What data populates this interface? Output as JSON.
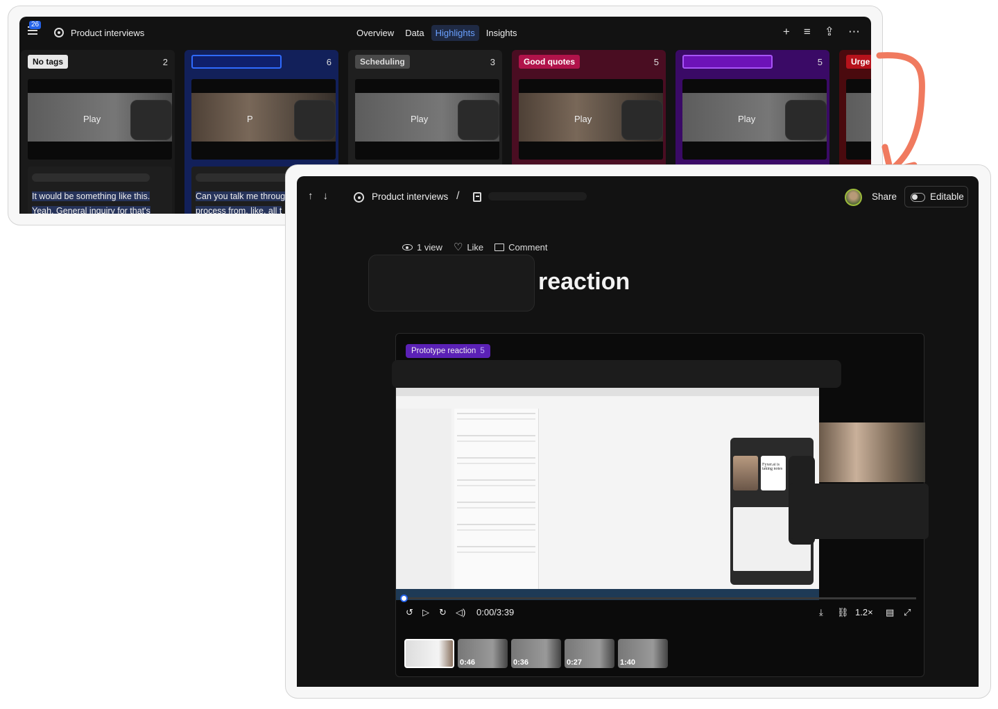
{
  "board": {
    "notif_count": "26",
    "project_title": "Product interviews",
    "tabs": [
      "Overview",
      "Data",
      "Highlights",
      "Insights"
    ],
    "active_tab": "Highlights",
    "columns": [
      {
        "tag": "No tags",
        "count": "2",
        "tag_bg": "#e8e8e8",
        "tag_fg": "#111111",
        "col_bg": "#1a1a1a",
        "play": "Play",
        "transcript": [
          "It would be something like this.",
          "Yeah. General inquiry for that's"
        ]
      },
      {
        "tag": "",
        "count": "6",
        "tag_bg": "#0f1f6b",
        "tag_fg": "#ffffff",
        "col_bg": "#12205a",
        "play": "P",
        "transcript": [
          "Can you talk me throug",
          "process from, like, all t"
        ]
      },
      {
        "tag": "Scheduling",
        "count": "3",
        "tag_bg": "#4a4a4a",
        "tag_fg": "#dddddd",
        "col_bg": "#1f1f1f",
        "play": "Play",
        "transcript": []
      },
      {
        "tag": "Good quotes",
        "count": "5",
        "tag_bg": "#b0134a",
        "tag_fg": "#ffffff",
        "col_bg": "#4a0d22",
        "play": "Play",
        "transcript": []
      },
      {
        "tag": "",
        "count": "5",
        "tag_bg": "#6d12b8",
        "tag_fg": "#ffffff",
        "col_bg": "#3a0a66",
        "play": "Play",
        "transcript": []
      },
      {
        "tag": "Urge",
        "count": "",
        "tag_bg": "#b5121b",
        "tag_fg": "#ffffff",
        "col_bg": "#4a0a0e",
        "play": "",
        "transcript": []
      }
    ]
  },
  "highlight": {
    "project_title": "Product interviews",
    "share_label": "Share",
    "editable_label": "Editable",
    "views": "1 view",
    "like_label": "Like",
    "comment_label": "Comment",
    "title": "reaction",
    "tag_chip": "Prototype reaction",
    "tag_chip_count": "5",
    "screen_note": "Fyxer.ai is taking notes",
    "time": "0:00/3:39",
    "speed": "1.2×",
    "clip_durations": [
      "",
      "0:46",
      "0:36",
      "0:27",
      "1:40"
    ]
  },
  "colors": {
    "accent": "#2563eb",
    "arrow": "#f07a5f",
    "tag_purple": "#5b21b6"
  }
}
